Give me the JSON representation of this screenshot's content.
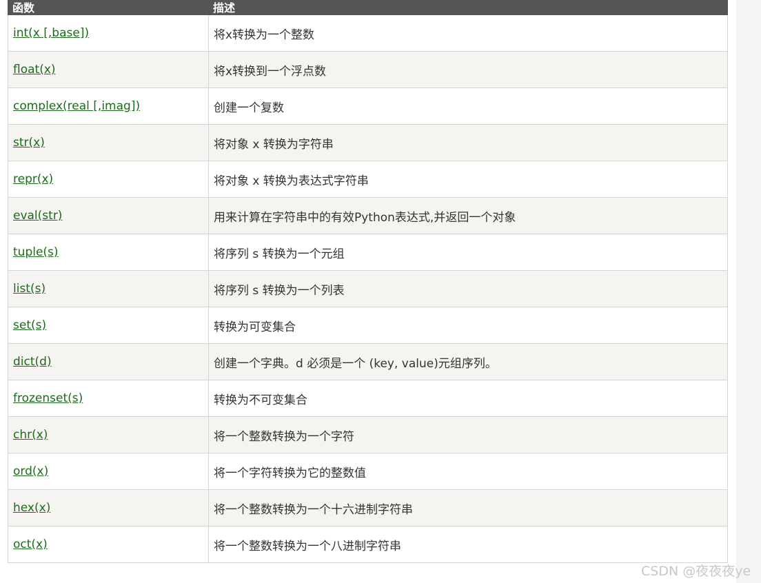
{
  "table": {
    "headers": [
      "函数",
      "描述"
    ],
    "rows": [
      {
        "fn": "int(x [,base])",
        "desc": "将x转换为一个整数"
      },
      {
        "fn": "float(x)",
        "desc": "将x转换到一个浮点数"
      },
      {
        "fn": "complex(real [,imag])",
        "desc": "创建一个复数"
      },
      {
        "fn": "str(x)",
        "desc": "将对象 x 转换为字符串"
      },
      {
        "fn": "repr(x)",
        "desc": "将对象 x 转换为表达式字符串"
      },
      {
        "fn": "eval(str)",
        "desc": "用来计算在字符串中的有效Python表达式,并返回一个对象"
      },
      {
        "fn": "tuple(s)",
        "desc": "将序列 s 转换为一个元组"
      },
      {
        "fn": "list(s)",
        "desc": "将序列 s 转换为一个列表"
      },
      {
        "fn": "set(s)",
        "desc": "转换为可变集合"
      },
      {
        "fn": "dict(d)",
        "desc": "创建一个字典。d 必须是一个 (key, value)元组序列。"
      },
      {
        "fn": "frozenset(s)",
        "desc": "转换为不可变集合"
      },
      {
        "fn": "chr(x)",
        "desc": "将一个整数转换为一个字符"
      },
      {
        "fn": "ord(x)",
        "desc": "将一个字符转换为它的整数值"
      },
      {
        "fn": "hex(x)",
        "desc": "将一个整数转换为一个十六进制字符串"
      },
      {
        "fn": "oct(x)",
        "desc": "将一个整数转换为一个八进制字符串"
      }
    ]
  },
  "watermark": "CSDN @夜夜夜ye"
}
